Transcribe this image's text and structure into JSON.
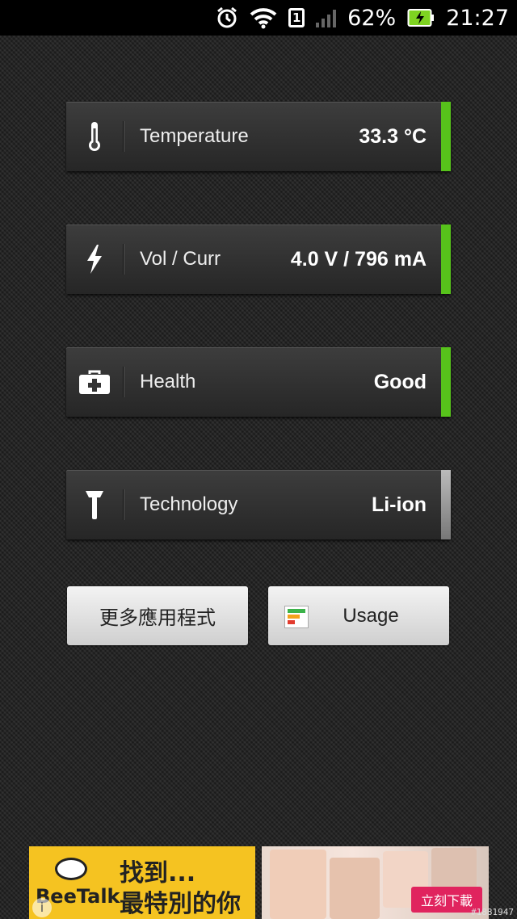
{
  "status_bar": {
    "battery_percent": "62%",
    "time": "21:27",
    "sim_label": "1",
    "icons": [
      "alarm-icon",
      "wifi-icon",
      "sim-icon",
      "signal-icon",
      "battery-charging-icon"
    ]
  },
  "cards": [
    {
      "label": "Temperature",
      "value": "33.3 °C",
      "icon": "thermometer-icon",
      "bar_color": "#57c21b"
    },
    {
      "label": "Vol / Curr",
      "value": "4.0 V / 796 mA",
      "icon": "lightning-icon",
      "bar_color": "#57c21b"
    },
    {
      "label": "Health",
      "value": "Good",
      "icon": "first-aid-icon",
      "bar_color": "#57c21b"
    },
    {
      "label": "Technology",
      "value": "Li-ion",
      "icon": "hammer-icon",
      "bar_color": "#9a9a9a"
    }
  ],
  "buttons": {
    "more_apps": "更多應用程式",
    "usage": "Usage"
  },
  "ad": {
    "brand": "BeeTalk",
    "headline_1": "找到...",
    "headline_2": "最特別的你",
    "cta": "立刻下載"
  },
  "watermark": "#1881947"
}
